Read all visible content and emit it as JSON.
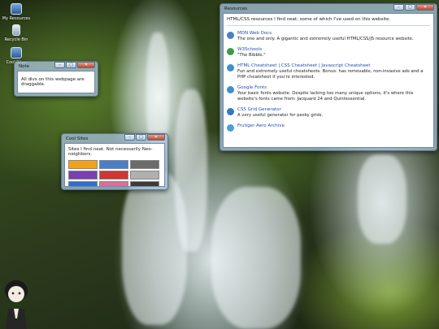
{
  "desktop": {
    "icons": [
      {
        "label": "My Resources"
      },
      {
        "label": "Recycle Bin"
      },
      {
        "label": "Cool Sites"
      }
    ]
  },
  "note_window": {
    "title": "Note",
    "text": "All divs on this webpage are draggable."
  },
  "cool_sites_window": {
    "title": "Cool Sites",
    "text": "Sites I find neat. Not necessarily Neo-neighbors.",
    "badge_colors": [
      "#f2a21a",
      "#4a7fc8",
      "#6b6b6b",
      "#7a3fb0",
      "#d13434",
      "#b0b0b0",
      "#2a6fd1",
      "#d96e9c",
      "#3b3b3b"
    ]
  },
  "resources_window": {
    "title": "Resources",
    "intro": "HTML/CSS resources I find neat; some of which I've used on this website.",
    "items": [
      {
        "link": "MDN Web Docs",
        "desc": "The one and only. A gigantic and extremely useful HTML/CSS/JS resource website.",
        "icon_color": "#4a7fc8"
      },
      {
        "link": "W3Schools",
        "desc": "\"The Bibble.\"",
        "icon_color": "#3b9a4a"
      },
      {
        "link": "HTML Cheatsheet | CSS Cheatsheet | Javascript Cheatsheet",
        "desc": "Fun and extremely useful cheatsheets. Bonus: has removable, non-invasive ads and a PHP cheatsheet if you're interested.",
        "icon_color": "#3f8fd0"
      },
      {
        "link": "Google Fonts",
        "desc": "Your basic fonts website. Despite lacking too many unique options, it's where this website's fonts came from: Jacquard 24 and Quintessential.",
        "icon_color": "#3f8fd0"
      },
      {
        "link": "CSS Grid Generator",
        "desc": "A very useful generator for pesky grids.",
        "icon_color": "#2f7ac2"
      },
      {
        "link": "Frutiger Aero Archive",
        "desc": "",
        "icon_color": "#4aa0d8"
      }
    ]
  },
  "controls": {
    "minimize": "–",
    "maximize": "□",
    "close": "✕"
  }
}
